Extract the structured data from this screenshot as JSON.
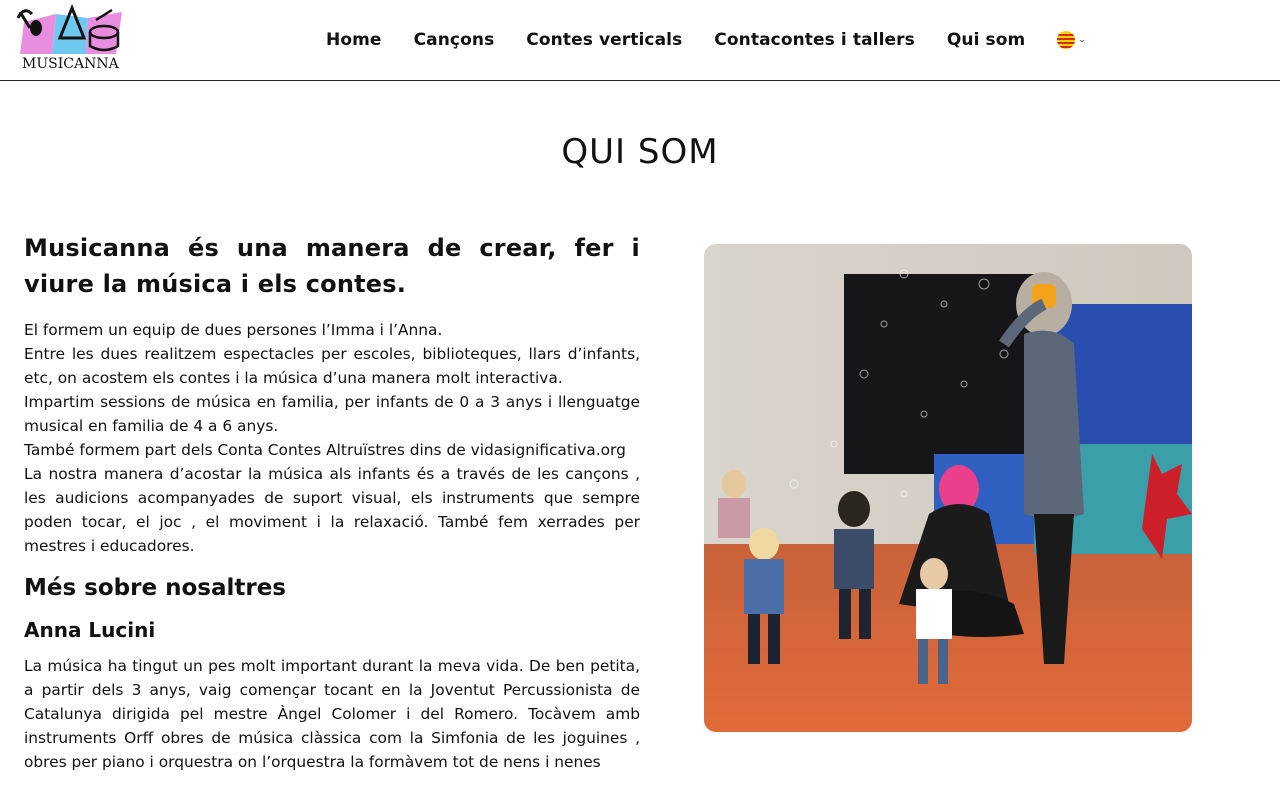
{
  "brand": {
    "logo_text": "MUSICANNA"
  },
  "nav": {
    "items": [
      {
        "label": "Home"
      },
      {
        "label": "Cançons"
      },
      {
        "label": "Contes verticals"
      },
      {
        "label": "Contacontes i tallers"
      },
      {
        "label": "Qui som"
      }
    ],
    "language_icon": "catalan-flag-icon",
    "language_dropdown_icon": "chevron-down-icon"
  },
  "page": {
    "title": "QUI SOM"
  },
  "content": {
    "headline": "Musicanna és una manera de crear, fer i viure la música i els contes.",
    "paragraphs": [
      "El formem un equip de dues persones l’Imma i l’Anna.",
      "Entre les dues realitzem espectacles per escoles, biblioteques, llars d’infants, etc, on acostem els contes i la música d’una manera molt interactiva.",
      "Impartim sessions de música en familia, per infants de 0 a 3 anys i llenguatge musical en familia de 4 a 6 anys.",
      "També formem part dels Conta Contes Altruïstres dins de vidasignificativa.org",
      "La nostra manera d’acostar la música als infants és a través de les cançons , les audicions acompanyades de suport visual, els instruments que sempre poden tocar, el joc , el moviment i la relaxació. També fem xerrades per mestres i educadores."
    ],
    "section_title": "Més sobre nosaltres",
    "person_name": "Anna Lucini",
    "person_bio": "La música ha tingut un pes molt important durant la meva vida. De ben petita, a partir dels 3 anys, vaig començar tocant en la Joventut Percussionista de Catalunya dirigida pel mestre Àngel Colomer i del Romero. Tocàvem amb instruments Orff obres de música clàssica com la Simfonia de les joguines , obres per piano i orquestra on l’orquestra la formàvem tot de nens i nenes"
  },
  "colors": {
    "text": "#111111",
    "logo_pink": "#e98de0",
    "logo_blue": "#6fc8ef",
    "flag_yellow": "#f6d300",
    "flag_red": "#d52b1e"
  }
}
